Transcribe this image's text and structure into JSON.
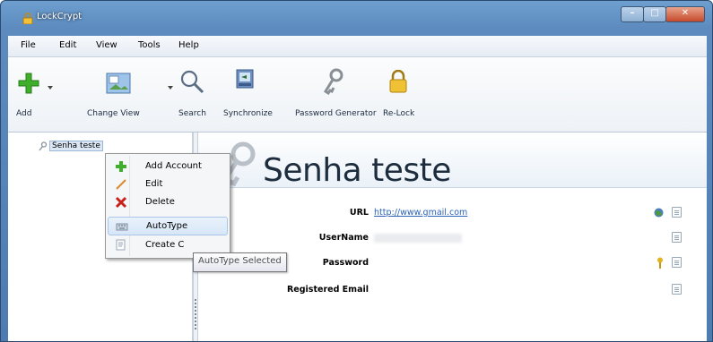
{
  "window": {
    "title": "LockCrypt"
  },
  "menu": [
    "File",
    "Edit",
    "View",
    "Tools",
    "Help"
  ],
  "toolbar": {
    "add": "Add",
    "change_view": "Change View",
    "search": "Search",
    "synchronize": "Synchronize",
    "password_generator": "Password Generator",
    "relock": "Re-Lock"
  },
  "tree": {
    "items": [
      {
        "label": "Senha teste"
      }
    ]
  },
  "detail": {
    "title": "Senha teste",
    "fields": [
      {
        "label": "URL",
        "value": "http://www.gmail.com"
      },
      {
        "label": "UserName",
        "value": ""
      },
      {
        "label": "Password",
        "value": ""
      },
      {
        "label": "Registered Email",
        "value": ""
      }
    ]
  },
  "context_menu": {
    "items": [
      "Add Account",
      "Edit",
      "Delete",
      "AutoType",
      "Create C"
    ]
  },
  "tooltip": "AutoType Selected",
  "colors": {
    "accent": "#2a62b8",
    "selection": "#dbe7f5"
  }
}
